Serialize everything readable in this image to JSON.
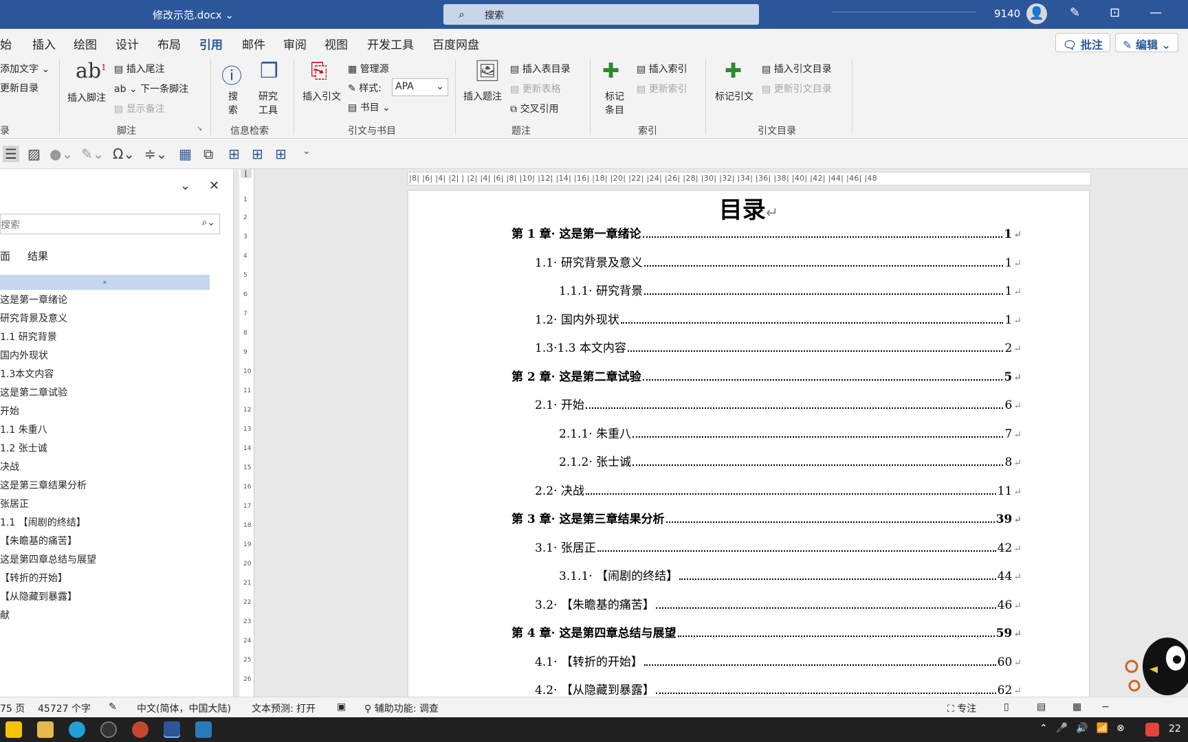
{
  "titlebar": {
    "doc_name": "修改示范.docx ⌄",
    "search_placeholder": "搜索",
    "user_number": "9140"
  },
  "tabs": [
    "始",
    "插入",
    "绘图",
    "设计",
    "布局",
    "引用",
    "邮件",
    "审阅",
    "视图",
    "开发工具",
    "百度网盘"
  ],
  "active_tab": "引用",
  "right_buttons": {
    "comment": "批注",
    "edit": "编辑 ⌄"
  },
  "ribbon": {
    "toc_group": {
      "add_text": "添加文字 ⌄",
      "update_toc": "更新目录",
      "label": "录"
    },
    "footnotes": {
      "insert_footnote": "插入脚注",
      "insert_endnote": "插入尾注",
      "next_footnote": "下一条脚注",
      "show_notes": "显示备注",
      "label": "脚注"
    },
    "research": {
      "search": "搜\n索",
      "research_tool": "研究\n工具",
      "label": "信息检索"
    },
    "citations": {
      "insert_citation": "插入引文",
      "manage_sources": "管理源",
      "style_label": "样式:",
      "style_value": "APA",
      "bibliography": "书目 ⌄",
      "label": "引文与书目"
    },
    "captions": {
      "insert_caption": "插入题注",
      "insert_table_of_figures": "插入表目录",
      "update_table": "更新表格",
      "cross_reference": "交叉引用",
      "label": "题注"
    },
    "index": {
      "mark_entry": "标记\n条目",
      "insert_index": "插入索引",
      "update_index": "更新索引",
      "label": "索引"
    },
    "toa": {
      "mark_citation": "标记引文",
      "insert_toa": "插入引文目录",
      "update_toa": "更新引文目录",
      "label": "引文目录"
    }
  },
  "nav": {
    "search_placeholder": "搜索",
    "tabs": [
      "面",
      "结果"
    ],
    "items": [
      "这是第一章绪论",
      "研究背景及意义",
      "1.1 研究背景",
      "国内外现状",
      "1.3本文内容",
      "这是第二章试验",
      "开始",
      "1.1 朱重八",
      "1.2 张士诚",
      "决战",
      "这是第三章结果分析",
      "张居正",
      "1.1 【闹剧的终结】",
      "【朱瞻基的痛苦】",
      "这是第四章总结与展望",
      "【转折的开始】",
      "【从隐藏到暴露】",
      "献"
    ]
  },
  "ruler_text": "|8| |6| |4| |2| |  |2| |4| |6| |8| |10| |12| |14| |16| |18| |20| |22| |24| |26| |28| |30| |32| |34| |36| |38| |40| |42| |44| |46| |48",
  "document": {
    "title": "目录",
    "paragraph_mark": "↵",
    "toc": [
      {
        "label": "第 1 章· 这是第一章绪论",
        "page": "1",
        "level": 1
      },
      {
        "label": "1.1· 研究背景及意义",
        "page": "1",
        "level": 2
      },
      {
        "label": "1.1.1· 研究背景",
        "page": "1",
        "level": 3
      },
      {
        "label": "1.2· 国内外现状",
        "page": "1",
        "level": 2
      },
      {
        "label": "1.3·1.3 本文内容",
        "page": "2",
        "level": 2
      },
      {
        "label": "第 2 章· 这是第二章试验",
        "page": "5",
        "level": 1
      },
      {
        "label": "2.1· 开始",
        "page": "6",
        "level": 2
      },
      {
        "label": "2.1.1· 朱重八",
        "page": "7",
        "level": 3
      },
      {
        "label": "2.1.2· 张士诚",
        "page": "8",
        "level": 3
      },
      {
        "label": "2.2· 决战",
        "page": "11",
        "level": 2
      },
      {
        "label": "第 3 章· 这是第三章结果分析",
        "page": "39",
        "level": 1
      },
      {
        "label": "3.1· 张居正",
        "page": "42",
        "level": 2
      },
      {
        "label": "3.1.1· 【闹剧的终结】",
        "page": "44",
        "level": 3
      },
      {
        "label": "3.2· 【朱瞻基的痛苦】",
        "page": "46",
        "level": 2
      },
      {
        "label": "第 4 章· 这是第四章总结与展望",
        "page": "59",
        "level": 1
      },
      {
        "label": "4.1· 【转折的开始】",
        "page": "60",
        "level": 2
      },
      {
        "label": "4.2· 【从隐藏到暴露】",
        "page": "62",
        "level": 2
      }
    ]
  },
  "status": {
    "pages": "75 页",
    "words": "45727 个字",
    "language": "中文(简体，中国大陆)",
    "text_prediction": "文本预测: 打开",
    "accessibility": "辅助功能: 调查",
    "focus": "专注"
  },
  "taskbar": {
    "clock": "22"
  }
}
